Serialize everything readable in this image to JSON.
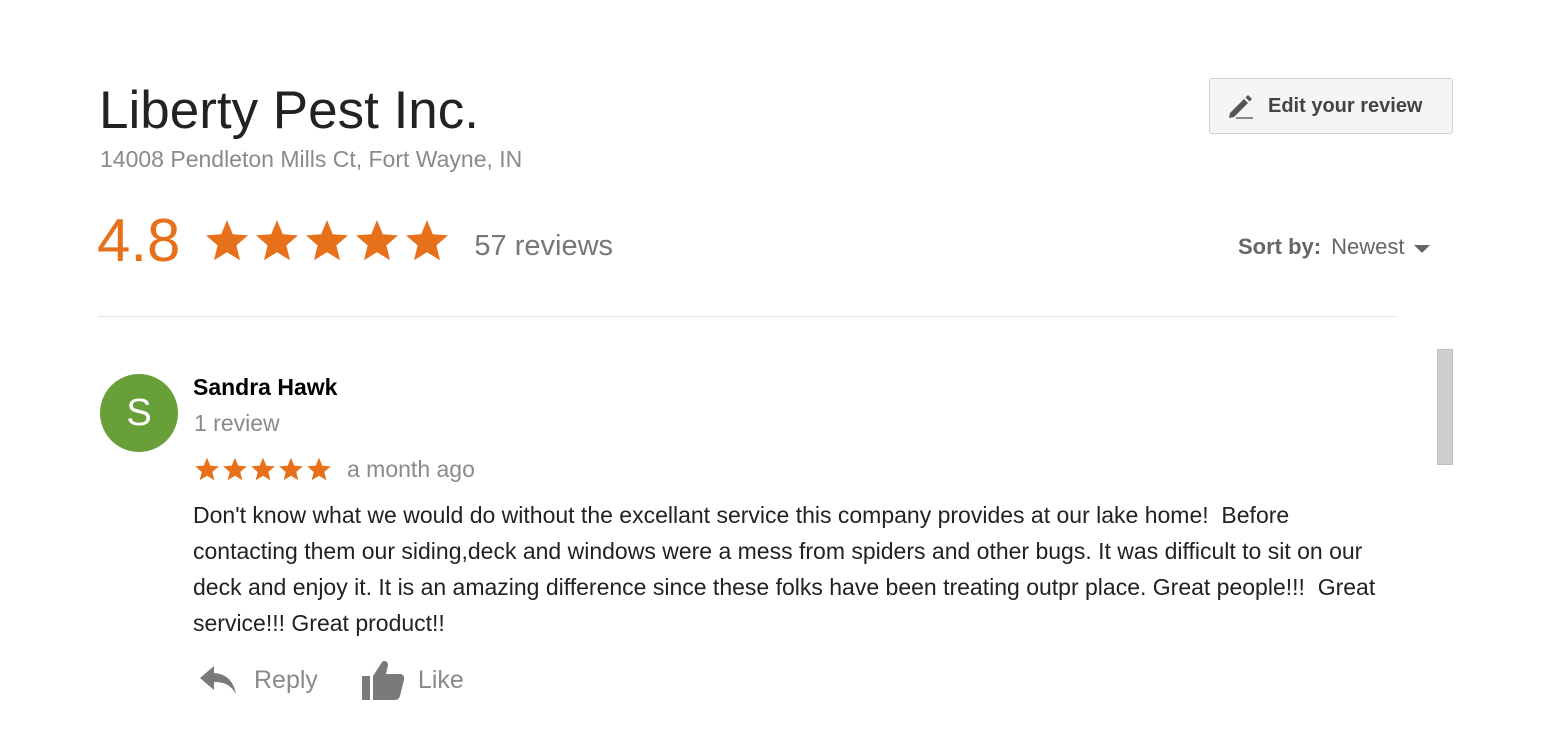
{
  "business": {
    "name": "Liberty Pest Inc.",
    "address": "14008 Pendleton Mills Ct, Fort Wayne, IN"
  },
  "edit_button": {
    "label": "Edit your review",
    "icon": "pencil-icon"
  },
  "summary": {
    "rating": "4.8",
    "stars": 5,
    "review_count_label": "57 reviews",
    "star_color": "#e7711b"
  },
  "sort": {
    "label": "Sort by:",
    "value": "Newest"
  },
  "reviews": [
    {
      "avatar_letter": "S",
      "avatar_color": "#689f38",
      "name": "Sandra Hawk",
      "reviewer_review_count": "1 review",
      "stars": 5,
      "time": "a month ago",
      "text": "Don't know what we would do without the excellant service this company provides at our lake home!  Before contacting them our siding,deck and windows were a mess from spiders and other bugs. It was difficult to sit on our deck and enjoy it. It is an amazing difference since these folks have been treating outpr place. Great people!!!  Great service!!! Great product!!",
      "actions": {
        "reply_label": "Reply",
        "like_label": "Like"
      }
    }
  ]
}
